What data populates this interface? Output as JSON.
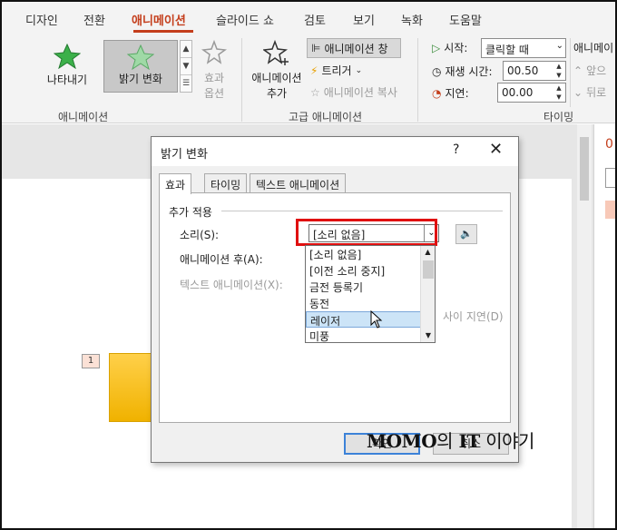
{
  "ribbon_tabs": [
    {
      "label": "디자인"
    },
    {
      "label": "전환"
    },
    {
      "label": "애니메이션"
    },
    {
      "label": "슬라이드 쇼"
    },
    {
      "label": "검토"
    },
    {
      "label": "보기"
    },
    {
      "label": "녹화"
    },
    {
      "label": "도움말"
    }
  ],
  "active_tab": "애니메이션",
  "animation_group": {
    "label": "애니메이션",
    "items": [
      {
        "label": "나타내기"
      },
      {
        "label": "밝기 변화"
      }
    ],
    "effect_options_line1": "효과",
    "effect_options_line2": "옵션"
  },
  "advanced_group": {
    "label": "고급 애니메이션",
    "add_animation_line1": "애니메이션",
    "add_animation_line2": "추가",
    "animation_pane": "애니메이션 창",
    "trigger": "트리거",
    "animation_painter": "애니메이션 복사"
  },
  "timing_group": {
    "label": "타이밍",
    "start_label": "시작:",
    "start_value": "클릭할 때",
    "duration_label": "재생 시간:",
    "duration_value": "00.50",
    "delay_label": "지연:",
    "delay_value": "00.00",
    "reorder_label": "애니메이",
    "move_earlier": "앞으",
    "move_later": "뒤로"
  },
  "slide": {
    "animation_tag": "1",
    "right_pane_text": "0"
  },
  "dialog": {
    "title": "밝기 변화",
    "help": "?",
    "close": "✕",
    "tabs": [
      {
        "label": "효과"
      },
      {
        "label": "타이밍"
      },
      {
        "label": "텍스트 애니메이션"
      }
    ],
    "section_label": "추가 적용",
    "sound_label": "소리(S):",
    "sound_value": "[소리 없음]",
    "after_anim_label": "애니메이션 후(A):",
    "animate_text_label": "텍스트 애니메이션(X):",
    "delay_between": "사이 지연(D)",
    "sound_options": [
      "[소리 없음]",
      "[이전 소리 중지]",
      "금전 등록기",
      "동전",
      "레이저",
      "미풍"
    ],
    "selected_option": "레이저",
    "ok_label": "확인",
    "cancel_label": "취소"
  },
  "watermark": {
    "brand": "MOMO",
    "mid": "의",
    "it": "IT",
    "tail": "이야기"
  },
  "colors": {
    "accent": "#c43e1c",
    "highlight": "#e01010",
    "star_green": "#3cb04a",
    "shape_fill": "#f5bd17"
  }
}
